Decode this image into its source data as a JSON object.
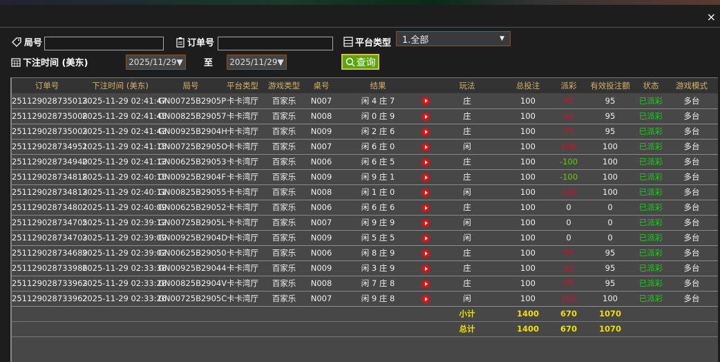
{
  "filters": {
    "round_label": "局号",
    "round_value": "",
    "order_label": "订单号",
    "order_value": "",
    "platform_label": "平台类型",
    "platform_value": "1.全部",
    "time_label": "下注时间 (美东)",
    "date_from": "2025/11/29▼",
    "to_label": "至",
    "date_to": "2025/11/29▼",
    "query_label": "查询"
  },
  "close_label": "×",
  "colors": {
    "win": "#d0102a",
    "loss": "#5fd000",
    "status": "#18d018",
    "header": "#d4b26a",
    "summary": "#f0e000"
  },
  "columns": [
    "订单号",
    "下注时间 (美东)",
    "局号",
    "平台类型",
    "游戏类型",
    "桌号",
    "结果",
    "",
    "玩法",
    "总投注",
    "派彩",
    "有效投注额",
    "状态",
    "游戏模式"
  ],
  "rows": [
    [
      "251129028735013",
      "2025-11-29 02:41:47",
      "GN00725B2905P",
      "卡卡湾厅",
      "百家乐",
      "N007",
      "闲 4 庄 7",
      "庄",
      "100",
      "95",
      "95",
      "已派彩",
      "多台"
    ],
    [
      "251129028735008",
      "2025-11-29 02:41:45",
      "GN00825B29057",
      "卡卡湾厅",
      "百家乐",
      "N008",
      "闲 0 庄 9",
      "庄",
      "100",
      "95",
      "95",
      "已派彩",
      "多台"
    ],
    [
      "251129028735003",
      "2025-11-29 02:41:43",
      "GN00925B2904H",
      "卡卡湾厅",
      "百家乐",
      "N009",
      "闲 2 庄 6",
      "庄",
      "100",
      "95",
      "95",
      "已派彩",
      "多台"
    ],
    [
      "251129028734951",
      "2025-11-29 02:41:15",
      "GN00725B2905O",
      "卡卡湾厅",
      "百家乐",
      "N007",
      "闲 6 庄 0",
      "闲",
      "100",
      "100",
      "100",
      "已派彩",
      "多台"
    ],
    [
      "251129028734940",
      "2025-11-29 02:41:13",
      "GN00625B29053",
      "卡卡湾厅",
      "百家乐",
      "N006",
      "闲 6 庄 5",
      "庄",
      "100",
      "-100",
      "100",
      "已派彩",
      "多台"
    ],
    [
      "251129028734818",
      "2025-11-29 02:40:15",
      "GN00925B2904F",
      "卡卡湾厅",
      "百家乐",
      "N009",
      "闲 9 庄 1",
      "庄",
      "100",
      "-100",
      "100",
      "已派彩",
      "多台"
    ],
    [
      "251129028734813",
      "2025-11-29 02:40:11",
      "GN00825B29055",
      "卡卡湾厅",
      "百家乐",
      "N008",
      "闲 1 庄 0",
      "闲",
      "100",
      "100",
      "100",
      "已派彩",
      "多台"
    ],
    [
      "251129028734802",
      "2025-11-29 02:40:09",
      "GN00625B29052",
      "卡卡湾厅",
      "百家乐",
      "N006",
      "闲 6 庄 6",
      "庄",
      "100",
      "0",
      "0",
      "已派彩",
      "多台"
    ],
    [
      "251129028734705",
      "2025-11-29 02:39:12",
      "GN00725B2905L",
      "卡卡湾厅",
      "百家乐",
      "N007",
      "闲 9 庄 9",
      "闲",
      "100",
      "0",
      "0",
      "已派彩",
      "多台"
    ],
    [
      "251129028734703",
      "2025-11-29 02:39:09",
      "GN00925B2904D",
      "卡卡湾厅",
      "百家乐",
      "N009",
      "闲 5 庄 5",
      "闲",
      "100",
      "0",
      "0",
      "已派彩",
      "多台"
    ],
    [
      "251129028734689",
      "2025-11-29 02:39:02",
      "GN00625B29050",
      "卡卡湾厅",
      "百家乐",
      "N006",
      "闲 8 庄 9",
      "庄",
      "100",
      "95",
      "95",
      "已派彩",
      "多台"
    ],
    [
      "251129028733986",
      "2025-11-29 02:33:38",
      "GN00925B29044",
      "卡卡湾厅",
      "百家乐",
      "N009",
      "闲 3 庄 9",
      "庄",
      "100",
      "95",
      "95",
      "已派彩",
      "多台"
    ],
    [
      "251129028733963",
      "2025-11-29 02:33:28",
      "GN00825B2904V",
      "卡卡湾厅",
      "百家乐",
      "N008",
      "闲 7 庄 8",
      "庄",
      "100",
      "95",
      "95",
      "已派彩",
      "多台"
    ],
    [
      "251129028733962",
      "2025-11-29 02:33:26",
      "GN00725B2905C",
      "卡卡湾厅",
      "百家乐",
      "N007",
      "闲 9 庄 8",
      "闲",
      "100",
      "100",
      "100",
      "已派彩",
      "多台"
    ]
  ],
  "summary": [
    {
      "label": "小计",
      "total": "1400",
      "payout": "670",
      "valid": "1070"
    },
    {
      "label": "总计",
      "total": "1400",
      "payout": "670",
      "valid": "1070"
    }
  ]
}
